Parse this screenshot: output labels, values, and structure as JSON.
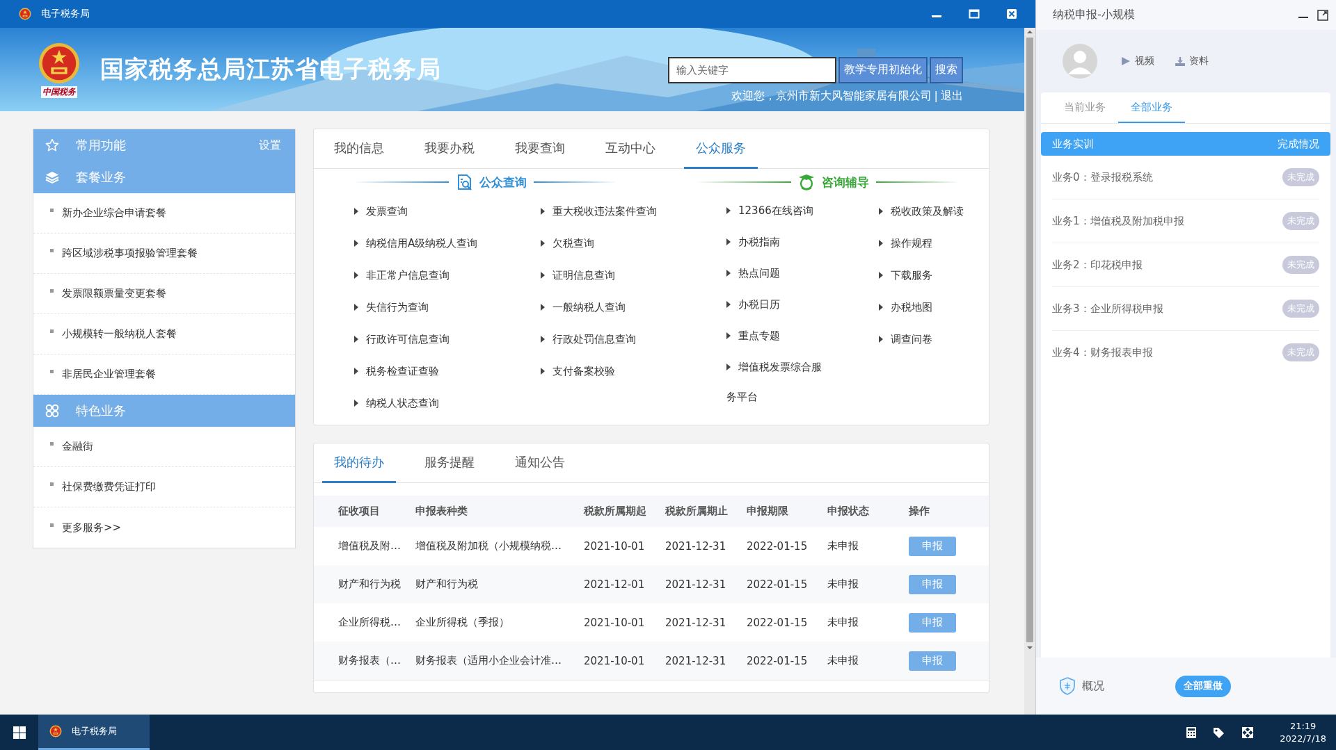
{
  "window": {
    "title": "电子税务局"
  },
  "header": {
    "site_title": "国家税务总局江苏省电子税务局",
    "logo_caption": "中国税务",
    "search": {
      "placeholder": "输入关键字"
    },
    "buttons": [
      "教学专用初始化",
      "搜索"
    ],
    "welcome": "欢迎您，京州市新大风智能家居有限公司",
    "separator": "|",
    "logout": "退出"
  },
  "sidebar": {
    "sections": [
      {
        "title": "常用功能",
        "action": "设置"
      },
      {
        "title": "套餐业务",
        "items": [
          "新办企业综合申请套餐",
          "跨区域涉税事项报验管理套餐",
          "发票限额票量变更套餐",
          "小规模转一般纳税人套餐",
          "非居民企业管理套餐"
        ]
      },
      {
        "title": "特色业务",
        "items": [
          "金融街",
          "社保费缴费凭证打印",
          "更多服务>>"
        ]
      }
    ]
  },
  "main_tabs": [
    {
      "label": "我的信息",
      "selected": false
    },
    {
      "label": "我要办税",
      "selected": false
    },
    {
      "label": "我要查询",
      "selected": false
    },
    {
      "label": "互动中心",
      "selected": false
    },
    {
      "label": "公众服务",
      "selected": true
    }
  ],
  "service_groups": [
    {
      "title": "公众查询",
      "color": "#2f8fd8",
      "columns": [
        [
          "发票查询",
          "纳税信用A级纳税人查询",
          "非正常户信息查询",
          "失信行为查询",
          "行政许可信息查询",
          "税务检查证查验",
          "纳税人状态查询"
        ],
        [
          "重大税收违法案件查询",
          "欠税查询",
          "证明信息查询",
          "一般纳税人查询",
          "行政处罚信息查询",
          "支付备案校验"
        ]
      ]
    },
    {
      "title": "咨询辅导",
      "color": "#3aa83a",
      "columns": [
        [
          "12366在线咨询",
          "办税指南",
          "热点问题",
          "办税日历",
          "重点专题",
          "增值税发票综合服务平台"
        ],
        [
          "税收政策及解读",
          "操作规程",
          "下载服务",
          "办税地图",
          "调查问卷"
        ]
      ]
    }
  ],
  "todo_panel": {
    "tabs": [
      {
        "label": "我的待办",
        "selected": true
      },
      {
        "label": "服务提醒",
        "selected": false
      },
      {
        "label": "通知公告",
        "selected": false
      }
    ],
    "table": {
      "columns": [
        "征收项目",
        "申报表种类",
        "税款所属期起",
        "税款所属期止",
        "申报期限",
        "申报状态",
        "操作"
      ],
      "rows": [
        {
          "cells": [
            "增值税及附…",
            "增值税及附加税（小规模纳税…",
            "2021-10-01",
            "2021-12-31",
            "2022-01-15",
            "未申报"
          ],
          "action": "申报"
        },
        {
          "cells": [
            "财产和行为税",
            "财产和行为税",
            "2021-12-01",
            "2021-12-31",
            "2022-01-15",
            "未申报"
          ],
          "action": "申报"
        },
        {
          "cells": [
            "企业所得税…",
            "企业所得税（季报）",
            "2021-10-01",
            "2021-12-31",
            "2022-01-15",
            "未申报"
          ],
          "action": "申报"
        },
        {
          "cells": [
            "财务报表（…",
            "财务报表（适用小企业会计准…",
            "2021-10-01",
            "2021-12-31",
            "2022-01-15",
            "未申报"
          ],
          "action": "申报"
        }
      ]
    }
  },
  "task_panel": {
    "title": "纳税申报-小规模",
    "links": [
      "视频",
      "资料"
    ],
    "tabs": [
      {
        "label": "当前业务",
        "selected": false
      },
      {
        "label": "全部业务",
        "selected": true
      }
    ],
    "header": [
      "业务实训",
      "完成情况"
    ],
    "tasks": [
      {
        "name": "业务0：登录报税系统",
        "status": "未完成"
      },
      {
        "name": "业务1：增值税及附加税申报",
        "status": "未完成"
      },
      {
        "name": "业务2：印花税申报",
        "status": "未完成"
      },
      {
        "name": "业务3：企业所得税申报",
        "status": "未完成"
      },
      {
        "name": "业务4：财务报表申报",
        "status": "未完成"
      }
    ],
    "overview": "概况",
    "reset_button": "全部重做"
  },
  "taskbar": {
    "apps": [
      {
        "label": "电子税务局",
        "selected": true
      }
    ],
    "time": "21:19",
    "date": "2022/7/18"
  }
}
